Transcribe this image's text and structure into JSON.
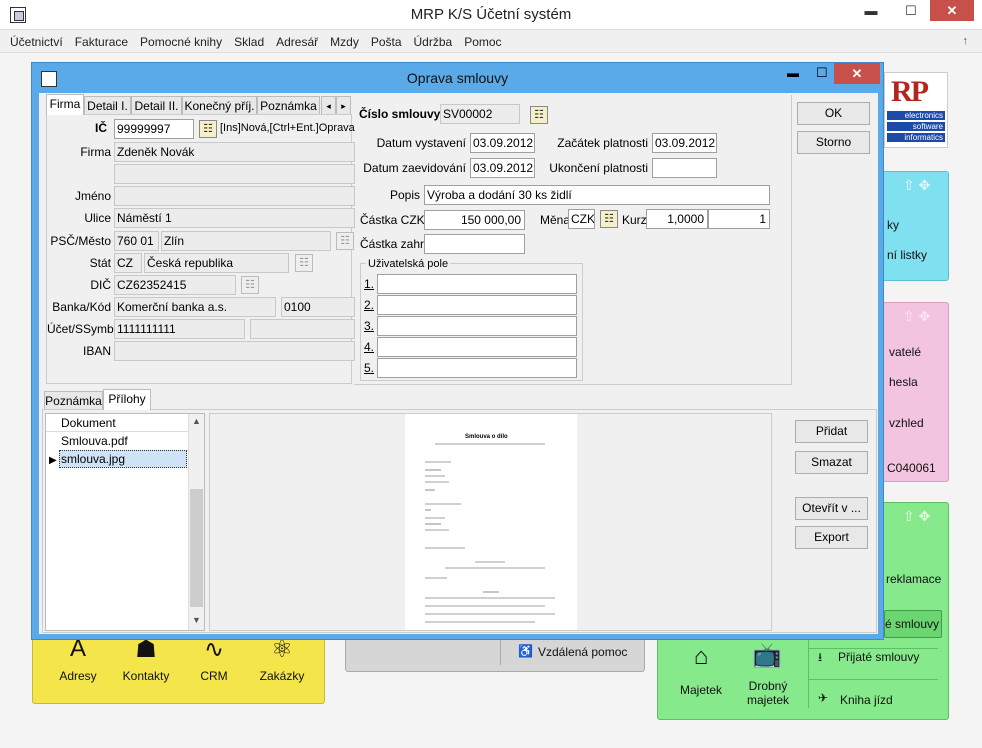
{
  "app": {
    "title": "MRP K/S Účetní systém",
    "minimize": "▬",
    "maximize": "☐",
    "close": "✕",
    "scroll_up": "↑"
  },
  "menu": [
    "Účetnictví",
    "Fakturace",
    "Pomocné knihy",
    "Sklad",
    "Adresář",
    "Mzdy",
    "Pošta",
    "Údržba",
    "Pomoc"
  ],
  "background": {
    "cyan_tile": {
      "items": [
        "ky",
        "ní listky"
      ]
    },
    "pink_tile": {
      "items": [
        "vatelé",
        "hesla",
        "vzhled",
        "C040061"
      ]
    },
    "green_tile": {
      "items": [
        "reklamace",
        "é smlouvy",
        "Přijaté smlouvy",
        "Kniha jízd"
      ],
      "icons": [
        {
          "label": "Majetek"
        },
        {
          "label": "Drobný majetek"
        }
      ]
    },
    "yellow_tile": {
      "icons": [
        {
          "label": "Adresy"
        },
        {
          "label": "Kontakty"
        },
        {
          "label": "CRM"
        },
        {
          "label": "Zakázky"
        }
      ]
    },
    "gray_tile": {
      "remote_help": "Vzdálená pomoc"
    },
    "logo": {
      "text": "RP",
      "lines": [
        "electronics",
        "software",
        "informatics"
      ]
    }
  },
  "dialog": {
    "title": "Oprava smlouvy",
    "tabs": [
      "Firma",
      "Detail I.",
      "Detail II.",
      "Konečný příj.",
      "Poznámka"
    ],
    "firma": {
      "ic_label": "IČ",
      "ic_value": "99999997",
      "ic_hint": "[Ins]Nová,[Ctrl+Ent.]Oprava",
      "firma_label": "Firma",
      "firma_value": "Zdeněk Novák",
      "jmeno_label": "Jméno",
      "ulice_label": "Ulice",
      "ulice_value": "Náměstí 1",
      "psc_label": "PSČ/Město",
      "psc_value": "760 01",
      "mesto_value": "Zlín",
      "stat_label": "Stát",
      "stat_code": "CZ",
      "stat_name": "Česká republika",
      "dic_label": "DIČ",
      "dic_value": "CZ62352415",
      "banka_label": "Banka/Kód",
      "banka_value": "Komerční banka a.s.",
      "banka_kod": "0100",
      "ucet_label": "Účet/SSymb",
      "ucet_value": "1111111111",
      "iban_label": "IBAN"
    },
    "contract": {
      "cislo_label": "Číslo smlouvy",
      "cislo_value": "SV00002",
      "datum_vystaveni_label": "Datum vystavení",
      "datum_vystaveni": "03.09.2012",
      "zacatek_label": "Začátek platnosti",
      "zacatek": "03.09.2012",
      "datum_zaevidovani_label": "Datum zaevidování",
      "datum_zaevidovani": "03.09.2012",
      "ukonceni_label": "Ukončení platnosti",
      "ukonceni": "",
      "popis_label": "Popis",
      "popis": "Výroba a dodání 30 ks židlí",
      "castka_czk_label": "Částka CZK",
      "castka_czk": "150 000,00",
      "mena_label": "Měna",
      "mena": "CZK",
      "kurz_label": "Kurz",
      "kurz": "1,0000",
      "kurz_jednotka": "1",
      "castka_zahr_label": "Částka zahr.",
      "castka_zahr": "",
      "user_fields_label": "Uživatelská pole",
      "user_fields": [
        "1.",
        "2.",
        "3.",
        "4.",
        "5."
      ]
    },
    "buttons": {
      "ok": "OK",
      "cancel": "Storno"
    },
    "lower_tabs": [
      "Poznámka",
      "Přílohy"
    ],
    "attachments": {
      "header": "Dokument",
      "files": [
        "Smlouva.pdf",
        "smlouva.jpg"
      ],
      "selected_index": 1
    },
    "attach_buttons": {
      "add": "Přidat",
      "delete": "Smazat",
      "open": "Otevřít v ...",
      "export": "Export"
    },
    "preview_title": "Smlouva o dílo"
  }
}
